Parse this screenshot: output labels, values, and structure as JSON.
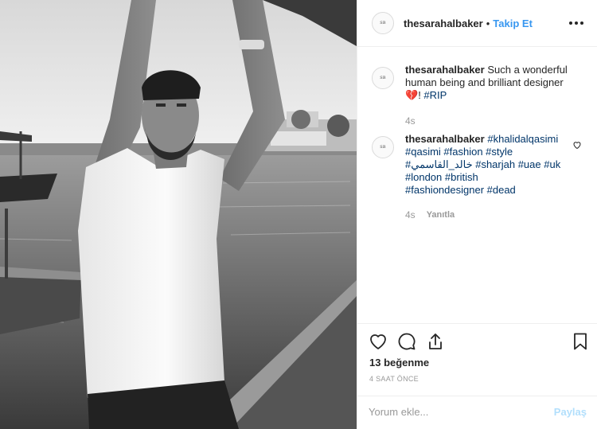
{
  "header": {
    "username": "thesarahalbaker",
    "separator": "•",
    "follow_label": "Takip Et",
    "avatar_logo": "SB"
  },
  "comments": [
    {
      "username": "thesarahalbaker",
      "text": "Such a wonderful human being and brilliant designer",
      "emoji": "💔",
      "tail": "! ",
      "tags": [
        "#RIP"
      ],
      "time": "4s"
    },
    {
      "username": "thesarahalbaker",
      "tags_line1": "#khalidalqasimi",
      "tags_line2": "#qasimi #fashion #style",
      "tags_line3": "#خالد_القاسمي #sharjah #uae #uk",
      "tags_line4": "#london #british",
      "tags_line5": "#fashiondesigner #dead",
      "time": "4s",
      "reply_label": "Yanıtla"
    }
  ],
  "actions": {
    "likes": "13 beğenme",
    "timestamp": "4 SAAT ÖNCE",
    "icons": [
      "heart-icon",
      "comment-icon",
      "share-icon",
      "bookmark-icon"
    ]
  },
  "add_comment": {
    "placeholder": "Yorum ekle...",
    "post_label": "Paylaş"
  },
  "colors": {
    "link": "#3897f0",
    "hashtag": "#003569",
    "muted": "#999999",
    "post_disabled": "#b2dffc",
    "border": "#efefef"
  }
}
